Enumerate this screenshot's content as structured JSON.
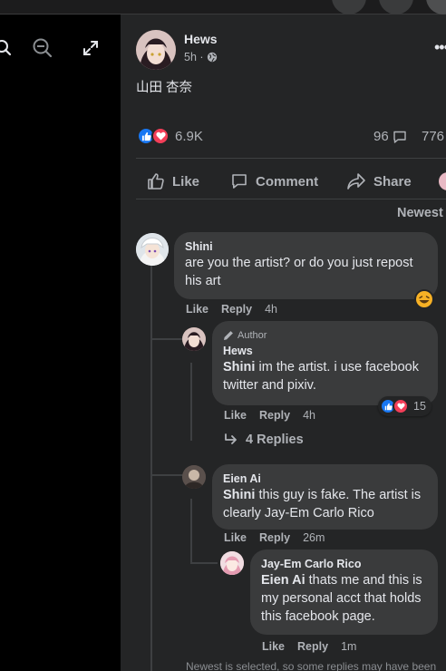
{
  "post": {
    "author": "Hews",
    "time": "5h ·",
    "text": "山田 杏奈",
    "reaction_count": "6.9K",
    "comment_count": "96",
    "share_count": "776"
  },
  "actions": {
    "like": "Like",
    "comment": "Comment",
    "share": "Share"
  },
  "sort_label": "Newest",
  "comments": [
    {
      "author": "Shini",
      "text": "are you the artist? or do you just repost his art",
      "like": "Like",
      "reply": "Reply",
      "time": "4h",
      "replies": [
        {
          "badge": "Author",
          "author": "Hews",
          "mention": "Shini",
          "text": "im the artist. i use facebook twitter and pixiv.",
          "like": "Like",
          "reply": "Reply",
          "time": "4h",
          "reaction_count": "15",
          "more_replies": "4 Replies"
        },
        {
          "author": "Eien Ai",
          "mention": "Shini",
          "text": "this guy is fake. The artist is clearly Jay-Em Carlo Rico",
          "like": "Like",
          "reply": "Reply",
          "time": "26m"
        },
        {
          "author": "Jay-Em Carlo Rico",
          "mention": "Eien Ai",
          "text": "thats me and this is my personal acct that holds this facebook page.",
          "like": "Like",
          "reply": "Reply",
          "time": "1m"
        }
      ]
    }
  ],
  "footnote": "Newest is selected, so some replies may have been",
  "colors": {
    "panel": "#242526",
    "bubble": "#3a3b3c",
    "like_blue": "#1877f2",
    "love_red": "#f33e58",
    "muted": "#b0b3b8"
  },
  "icons": [
    "search-icon",
    "zoom-out-icon",
    "fullscreen-icon",
    "globe-icon",
    "more-icon",
    "like-icon",
    "comment-icon",
    "share-icon",
    "reply-arrow-icon",
    "pencil-icon",
    "haha-icon"
  ]
}
